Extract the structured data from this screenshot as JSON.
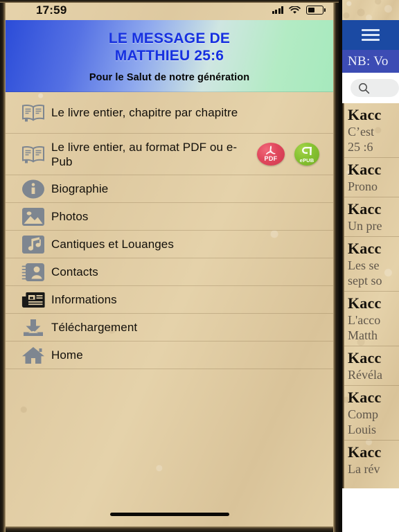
{
  "status_bar": {
    "time": "17:59",
    "signal_icon": "signal-dots-icon",
    "wifi_icon": "wifi-icon",
    "battery_icon": "battery-icon"
  },
  "header": {
    "title_line1": "LE MESSAGE DE",
    "title_line2": "MATTHIEU 25:6",
    "subtitle": "Pour le Salut de notre génération",
    "title_color": "#1630e0",
    "gradient_from": "#2b4cd8",
    "gradient_to": "#a6e9bd"
  },
  "menu": {
    "items": [
      {
        "label": "Le livre entier, chapitre par chapitre",
        "icon": "open-book-icon",
        "height": "tall",
        "badges": []
      },
      {
        "label": "Le livre entier, au format PDF ou e-Pub",
        "icon": "open-book-icon",
        "height": "tall",
        "badges": [
          {
            "name": "pdf-badge",
            "text": "PDF",
            "color": "#de4459"
          },
          {
            "name": "epub-badge",
            "text": "ePUB",
            "color": "#86c232"
          }
        ]
      },
      {
        "label": "Biographie",
        "icon": "info-circle-icon",
        "height": "std",
        "badges": []
      },
      {
        "label": "Photos",
        "icon": "photo-icon",
        "height": "std",
        "badges": []
      },
      {
        "label": "Cantiques et Louanges",
        "icon": "music-note-icon",
        "height": "std",
        "badges": []
      },
      {
        "label": "Contacts",
        "icon": "contact-card-icon",
        "height": "std",
        "badges": []
      },
      {
        "label": "Informations",
        "icon": "newspaper-icon",
        "height": "std",
        "badges": []
      },
      {
        "label": "Téléchargement",
        "icon": "download-icon",
        "height": "std",
        "badges": []
      },
      {
        "label": "Home",
        "icon": "home-icon",
        "height": "std",
        "badges": []
      }
    ]
  },
  "right_panel": {
    "menu_icon": "hamburger-menu-icon",
    "notice": "NB: Vo",
    "search": {
      "icon": "search-icon",
      "value": "",
      "placeholder": ""
    },
    "topbar_color": "#1b4aa3",
    "notice_color": "#3c4cb4",
    "items": [
      {
        "title": "Kacc",
        "lines": [
          "C’est",
          "25 :6"
        ]
      },
      {
        "title": "Kacc",
        "lines": [
          "Prono"
        ]
      },
      {
        "title": "Kacc",
        "lines": [
          "Un pre"
        ]
      },
      {
        "title": "Kacc",
        "lines": [
          "Les se",
          "sept so"
        ]
      },
      {
        "title": "Kacc",
        "lines": [
          "L'acco",
          "Matth"
        ]
      },
      {
        "title": "Kacc",
        "lines": [
          "Révéla"
        ]
      },
      {
        "title": "Kacc",
        "lines": [
          "Comp",
          "Louis"
        ]
      },
      {
        "title": "Kacc",
        "lines": [
          "La rév"
        ]
      }
    ]
  }
}
